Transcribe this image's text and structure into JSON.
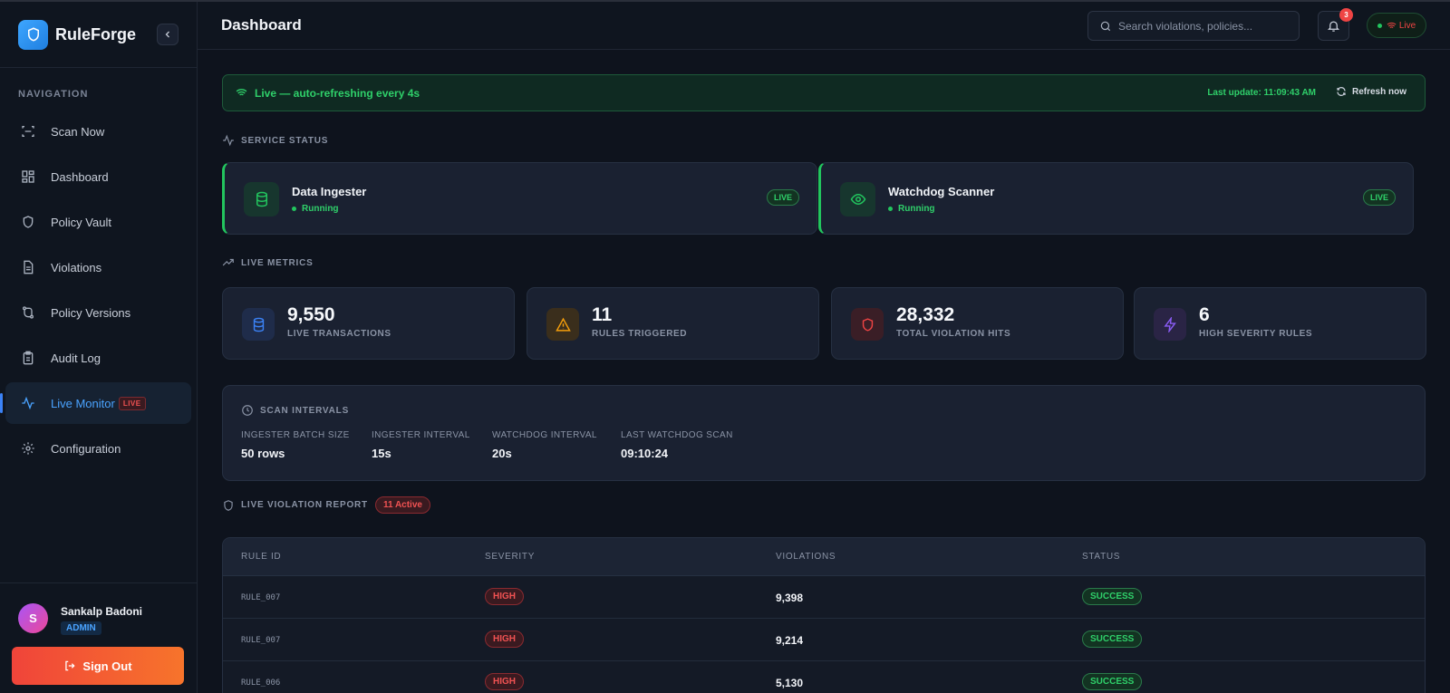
{
  "app": {
    "name": "RuleForge"
  },
  "sidebar": {
    "nav_title": "NAVIGATION",
    "items": [
      {
        "label": "Scan Now",
        "icon": "scan-icon"
      },
      {
        "label": "Dashboard",
        "icon": "dashboard-icon"
      },
      {
        "label": "Policy Vault",
        "icon": "shield-icon"
      },
      {
        "label": "Violations",
        "icon": "document-icon"
      },
      {
        "label": "Policy Versions",
        "icon": "git-branch-icon"
      },
      {
        "label": "Audit Log",
        "icon": "clipboard-icon"
      },
      {
        "label": "Live Monitor",
        "icon": "activity-icon",
        "tag": "LIVE",
        "active": true
      },
      {
        "label": "Configuration",
        "icon": "gear-icon"
      }
    ],
    "user": {
      "initial": "S",
      "name": "Sankalp Badoni",
      "role": "ADMIN"
    },
    "signout_label": "Sign Out"
  },
  "header": {
    "title": "Dashboard",
    "search_placeholder": "Search violations, policies...",
    "notification_count": "3",
    "live_label": "Live"
  },
  "banner": {
    "text": "Live — auto-refreshing every 4s",
    "last_update": "Last update: 11:09:43 AM",
    "refresh_label": "Refresh now"
  },
  "service_status": {
    "title": "SERVICE STATUS",
    "services": [
      {
        "name": "Data Ingester",
        "status": "Running",
        "badge": "LIVE",
        "icon": "database-icon"
      },
      {
        "name": "Watchdog Scanner",
        "status": "Running",
        "badge": "LIVE",
        "icon": "eye-icon"
      }
    ]
  },
  "live_metrics": {
    "title": "LIVE METRICS",
    "metrics": [
      {
        "value": "9,550",
        "label": "LIVE TRANSACTIONS",
        "icon": "database-icon",
        "color": "#3b82f6"
      },
      {
        "value": "11",
        "label": "RULES TRIGGERED",
        "icon": "warning-icon",
        "color": "#f59e0b"
      },
      {
        "value": "28,332",
        "label": "TOTAL VIOLATION HITS",
        "icon": "shield-icon",
        "color": "#ef4444"
      },
      {
        "value": "6",
        "label": "HIGH SEVERITY RULES",
        "icon": "bolt-icon",
        "color": "#8b5cf6"
      }
    ]
  },
  "scan_intervals": {
    "title": "SCAN INTERVALS",
    "items": [
      {
        "label": "INGESTER BATCH SIZE",
        "value": "50 rows"
      },
      {
        "label": "INGESTER INTERVAL",
        "value": "15s"
      },
      {
        "label": "WATCHDOG INTERVAL",
        "value": "20s"
      },
      {
        "label": "LAST WATCHDOG SCAN",
        "value": "09:10:24"
      }
    ]
  },
  "violation_report": {
    "title": "LIVE VIOLATION REPORT",
    "active_badge": "11 Active",
    "columns": [
      "RULE ID",
      "SEVERITY",
      "VIOLATIONS",
      "STATUS"
    ],
    "rows": [
      {
        "rule_id": "RULE_007",
        "severity": "HIGH",
        "violations": "9,398",
        "status": "SUCCESS"
      },
      {
        "rule_id": "RULE_007",
        "severity": "HIGH",
        "violations": "9,214",
        "status": "SUCCESS"
      },
      {
        "rule_id": "RULE_006",
        "severity": "HIGH",
        "violations": "5,130",
        "status": "SUCCESS"
      }
    ]
  },
  "colors": {
    "accent": "#3b82f6",
    "live_green": "#22c55e",
    "danger": "#ef4444",
    "signout_start": "#f0443a",
    "signout_end": "#f7742b"
  }
}
